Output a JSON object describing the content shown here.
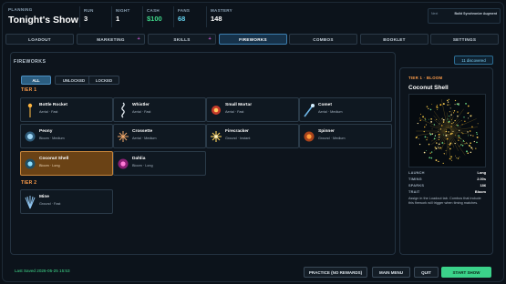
{
  "header": {
    "section": "PLANNING",
    "title": "Tonight's Show",
    "stats": [
      {
        "label": "RUN",
        "value": "3"
      },
      {
        "label": "NIGHT",
        "value": "1"
      },
      {
        "label": "CASH",
        "value": "$100"
      },
      {
        "label": "FANS",
        "value": "68"
      },
      {
        "label": "MASTERY",
        "value": "148"
      }
    ],
    "mini_left": "Next",
    "mini_right": "Build Synchronize Augment"
  },
  "tabs": [
    {
      "label": "LOADOUT"
    },
    {
      "label": "MARKETING",
      "badge": "+"
    },
    {
      "label": "SKILLS",
      "badge": "+"
    },
    {
      "label": "FIREWORKS"
    },
    {
      "label": "COMBOS"
    },
    {
      "label": "BOOKLET"
    },
    {
      "label": "SETTINGS"
    }
  ],
  "fireworks": {
    "title": "FIREWORKS",
    "discovered": "11 discovered",
    "filters": [
      "ALL",
      "UNLOCKED",
      "LOCKED"
    ],
    "tier1_label": "TIER 1",
    "tier2_label": "TIER 2",
    "cards": [
      {
        "name": "Bottle Rocket",
        "desc": "Aerial · Fast",
        "icon": "bottle-rocket-icon"
      },
      {
        "name": "Whistler",
        "desc": "Aerial · Fast",
        "icon": "whistler-icon"
      },
      {
        "name": "Small Mortar",
        "desc": "Aerial · Fast",
        "icon": "small-mortar-icon"
      },
      {
        "name": "Comet",
        "desc": "Aerial · Medium",
        "icon": "comet-icon"
      },
      {
        "name": "Peony",
        "desc": "Bloom · Medium",
        "icon": "peony-icon"
      },
      {
        "name": "Crossette",
        "desc": "Aerial · Medium",
        "icon": "crossette-icon"
      },
      {
        "name": "Firecracker",
        "desc": "Ground · Instant",
        "icon": "firecracker-icon"
      },
      {
        "name": "Spinner",
        "desc": "Ground · Medium",
        "icon": "spinner-icon"
      },
      {
        "name": "Coconut Shell",
        "desc": "Bloom · Long",
        "icon": "coconut-shell-icon"
      },
      {
        "name": "Dahlia",
        "desc": "Bloom · Long",
        "icon": "dahlia-icon"
      },
      {
        "name": "Mine",
        "desc": "Ground · Fast",
        "icon": "mine-icon"
      }
    ]
  },
  "detail": {
    "tier": "TIER 1 · BLOOM",
    "name": "Coconut Shell",
    "rows": [
      {
        "label": "LAUNCH",
        "value": "Long"
      },
      {
        "label": "TIMING",
        "value": "2.00s"
      },
      {
        "label": "SPARKS",
        "value": "186"
      },
      {
        "label": "TRAIT",
        "value": "Bloom"
      }
    ],
    "description": "Assign in the Loadout tab. Combos that include this firework will trigger when timing matches."
  },
  "footer": {
    "saved": "Last Saved 2026-05-25 15:53",
    "practice": "PRACTICE (NO REWARDS)",
    "main_menu": "MAIN MENU",
    "quit": "QUIT",
    "start": "START SHOW"
  },
  "colors": {
    "background": "#0b1118",
    "accent_orange": "#ff9d4a",
    "accent_green": "#3bd28a",
    "selected_card": "#6a4215",
    "active_tab": "#16324a"
  }
}
